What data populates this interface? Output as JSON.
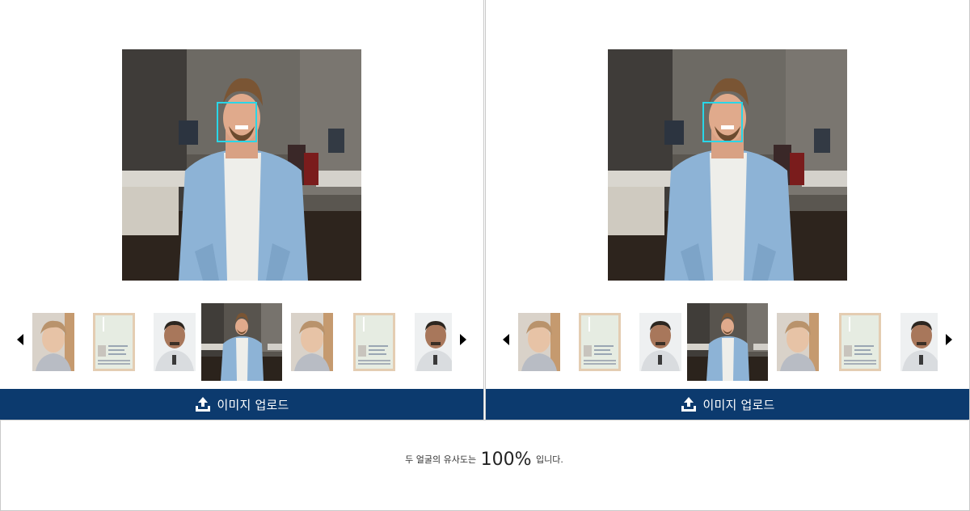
{
  "panels": [
    {
      "side": "left",
      "upload_label": "이미지 업로드",
      "selected_thumb_index": 3,
      "thumbnails": [
        "person-a",
        "passport-doc",
        "person-b",
        "office-man",
        "person-a",
        "passport-doc",
        "person-b"
      ]
    },
    {
      "side": "right",
      "upload_label": "이미지 업로드",
      "selected_thumb_index": 3,
      "thumbnails": [
        "person-a",
        "passport-doc",
        "person-b",
        "office-man",
        "person-a",
        "passport-doc",
        "person-b"
      ]
    }
  ],
  "result": {
    "prefix": "두 얼굴의 유사도는",
    "value": "100%",
    "suffix": "입니다."
  },
  "colors": {
    "upload_bar": "#0c3a6e",
    "face_box": "#29d6e8"
  }
}
